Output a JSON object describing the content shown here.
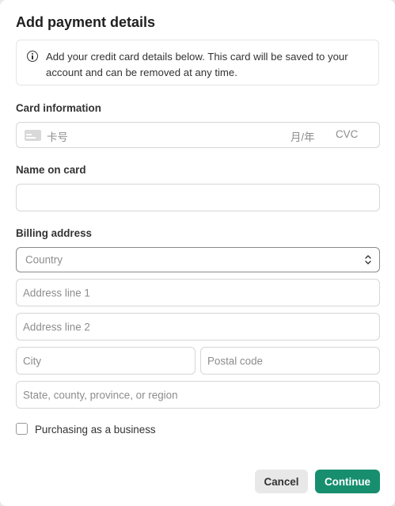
{
  "dialog": {
    "title": "Add payment details",
    "info_text": "Add your credit card details below. This card will be saved to your account and can be removed at any time."
  },
  "card_section": {
    "label": "Card information",
    "card_number_placeholder": "卡号",
    "expiry_placeholder": "月/年",
    "cvc_placeholder": "CVC"
  },
  "name_section": {
    "label": "Name on card",
    "value": ""
  },
  "billing": {
    "label": "Billing address",
    "country_placeholder": "Country",
    "address_line1_placeholder": "Address line 1",
    "address_line2_placeholder": "Address line 2",
    "city_placeholder": "City",
    "postal_placeholder": "Postal code",
    "region_placeholder": "State, county, province, or region"
  },
  "business": {
    "label": "Purchasing as a business",
    "checked": false
  },
  "actions": {
    "cancel_label": "Cancel",
    "continue_label": "Continue"
  },
  "colors": {
    "accent": "#178f6f",
    "cancel_bg": "#e8e8e8"
  }
}
